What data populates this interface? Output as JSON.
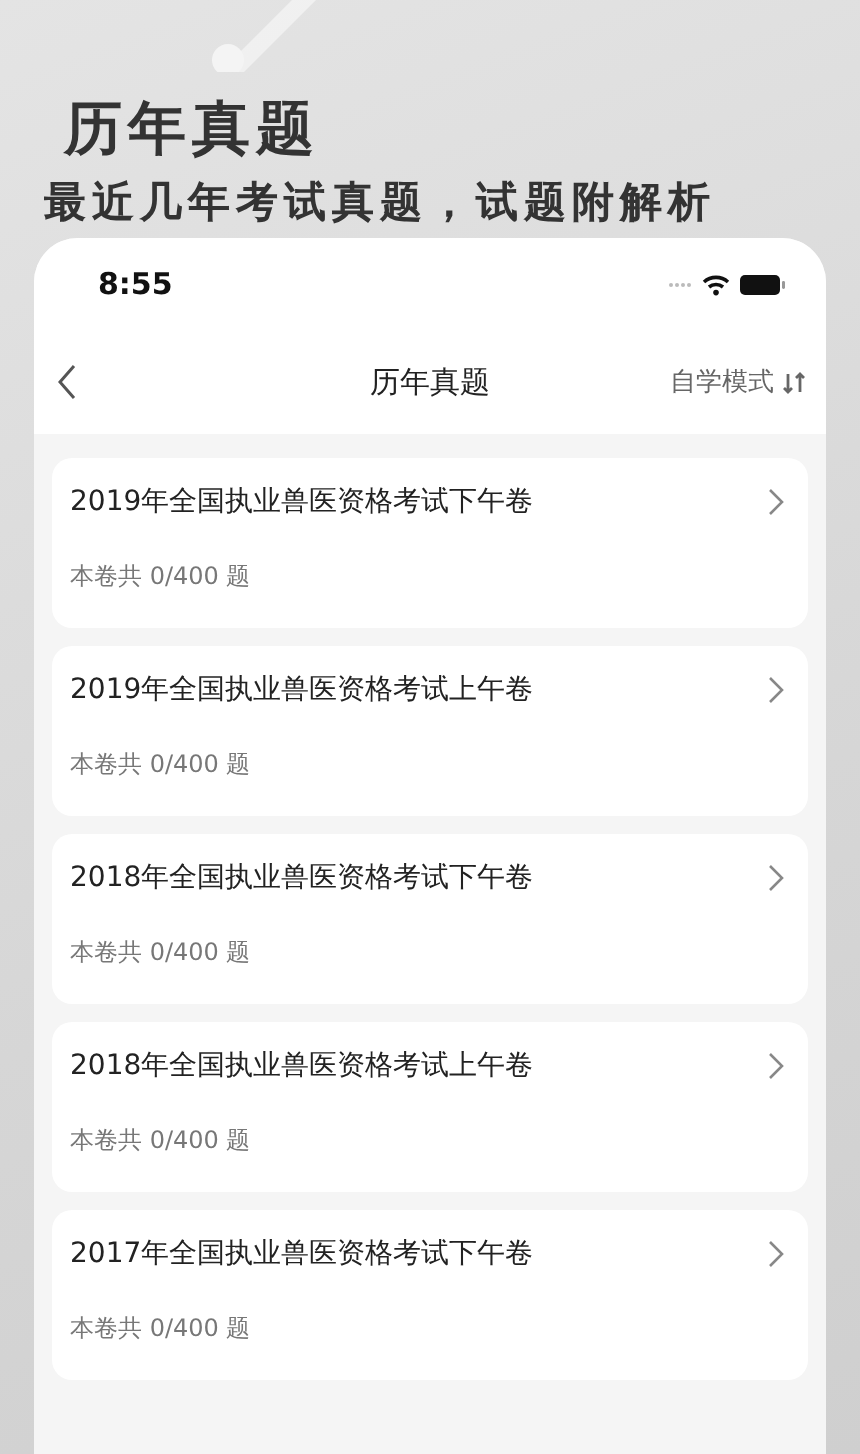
{
  "banner": {
    "title": "历年真题",
    "subtitle": "最近几年考试真题，试题附解析"
  },
  "status_bar": {
    "time": "8:55"
  },
  "nav_bar": {
    "title": "历年真题",
    "mode": "自学模式"
  },
  "papers": [
    {
      "title": "2019年全国执业兽医资格考试下午卷",
      "count": "本卷共 0/400 题"
    },
    {
      "title": "2019年全国执业兽医资格考试上午卷",
      "count": "本卷共 0/400 题"
    },
    {
      "title": "2018年全国执业兽医资格考试下午卷",
      "count": "本卷共 0/400 题"
    },
    {
      "title": "2018年全国执业兽医资格考试上午卷",
      "count": "本卷共 0/400 题"
    },
    {
      "title": "2017年全国执业兽医资格考试下午卷",
      "count": "本卷共 0/400 题"
    }
  ]
}
